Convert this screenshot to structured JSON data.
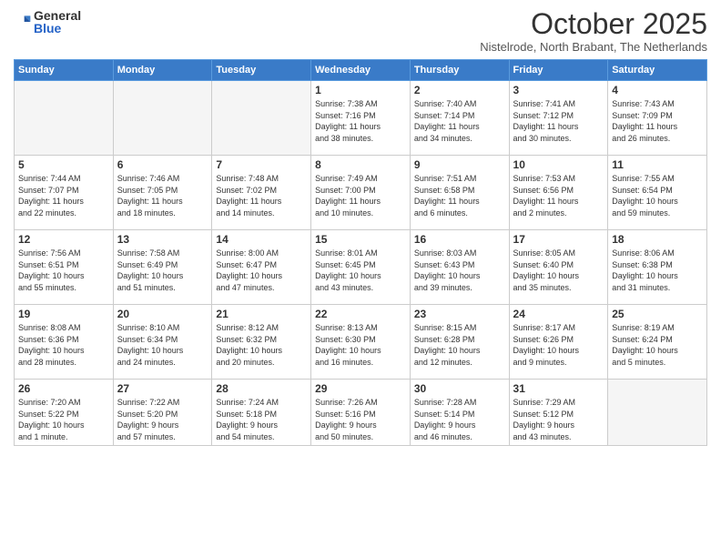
{
  "header": {
    "logo": {
      "general": "General",
      "blue": "Blue"
    },
    "title": "October 2025",
    "location": "Nistelrode, North Brabant, The Netherlands"
  },
  "days_of_week": [
    "Sunday",
    "Monday",
    "Tuesday",
    "Wednesday",
    "Thursday",
    "Friday",
    "Saturday"
  ],
  "weeks": [
    [
      {
        "day": "",
        "info": ""
      },
      {
        "day": "",
        "info": ""
      },
      {
        "day": "",
        "info": ""
      },
      {
        "day": "1",
        "info": "Sunrise: 7:38 AM\nSunset: 7:16 PM\nDaylight: 11 hours\nand 38 minutes."
      },
      {
        "day": "2",
        "info": "Sunrise: 7:40 AM\nSunset: 7:14 PM\nDaylight: 11 hours\nand 34 minutes."
      },
      {
        "day": "3",
        "info": "Sunrise: 7:41 AM\nSunset: 7:12 PM\nDaylight: 11 hours\nand 30 minutes."
      },
      {
        "day": "4",
        "info": "Sunrise: 7:43 AM\nSunset: 7:09 PM\nDaylight: 11 hours\nand 26 minutes."
      }
    ],
    [
      {
        "day": "5",
        "info": "Sunrise: 7:44 AM\nSunset: 7:07 PM\nDaylight: 11 hours\nand 22 minutes."
      },
      {
        "day": "6",
        "info": "Sunrise: 7:46 AM\nSunset: 7:05 PM\nDaylight: 11 hours\nand 18 minutes."
      },
      {
        "day": "7",
        "info": "Sunrise: 7:48 AM\nSunset: 7:02 PM\nDaylight: 11 hours\nand 14 minutes."
      },
      {
        "day": "8",
        "info": "Sunrise: 7:49 AM\nSunset: 7:00 PM\nDaylight: 11 hours\nand 10 minutes."
      },
      {
        "day": "9",
        "info": "Sunrise: 7:51 AM\nSunset: 6:58 PM\nDaylight: 11 hours\nand 6 minutes."
      },
      {
        "day": "10",
        "info": "Sunrise: 7:53 AM\nSunset: 6:56 PM\nDaylight: 11 hours\nand 2 minutes."
      },
      {
        "day": "11",
        "info": "Sunrise: 7:55 AM\nSunset: 6:54 PM\nDaylight: 10 hours\nand 59 minutes."
      }
    ],
    [
      {
        "day": "12",
        "info": "Sunrise: 7:56 AM\nSunset: 6:51 PM\nDaylight: 10 hours\nand 55 minutes."
      },
      {
        "day": "13",
        "info": "Sunrise: 7:58 AM\nSunset: 6:49 PM\nDaylight: 10 hours\nand 51 minutes."
      },
      {
        "day": "14",
        "info": "Sunrise: 8:00 AM\nSunset: 6:47 PM\nDaylight: 10 hours\nand 47 minutes."
      },
      {
        "day": "15",
        "info": "Sunrise: 8:01 AM\nSunset: 6:45 PM\nDaylight: 10 hours\nand 43 minutes."
      },
      {
        "day": "16",
        "info": "Sunrise: 8:03 AM\nSunset: 6:43 PM\nDaylight: 10 hours\nand 39 minutes."
      },
      {
        "day": "17",
        "info": "Sunrise: 8:05 AM\nSunset: 6:40 PM\nDaylight: 10 hours\nand 35 minutes."
      },
      {
        "day": "18",
        "info": "Sunrise: 8:06 AM\nSunset: 6:38 PM\nDaylight: 10 hours\nand 31 minutes."
      }
    ],
    [
      {
        "day": "19",
        "info": "Sunrise: 8:08 AM\nSunset: 6:36 PM\nDaylight: 10 hours\nand 28 minutes."
      },
      {
        "day": "20",
        "info": "Sunrise: 8:10 AM\nSunset: 6:34 PM\nDaylight: 10 hours\nand 24 minutes."
      },
      {
        "day": "21",
        "info": "Sunrise: 8:12 AM\nSunset: 6:32 PM\nDaylight: 10 hours\nand 20 minutes."
      },
      {
        "day": "22",
        "info": "Sunrise: 8:13 AM\nSunset: 6:30 PM\nDaylight: 10 hours\nand 16 minutes."
      },
      {
        "day": "23",
        "info": "Sunrise: 8:15 AM\nSunset: 6:28 PM\nDaylight: 10 hours\nand 12 minutes."
      },
      {
        "day": "24",
        "info": "Sunrise: 8:17 AM\nSunset: 6:26 PM\nDaylight: 10 hours\nand 9 minutes."
      },
      {
        "day": "25",
        "info": "Sunrise: 8:19 AM\nSunset: 6:24 PM\nDaylight: 10 hours\nand 5 minutes."
      }
    ],
    [
      {
        "day": "26",
        "info": "Sunrise: 7:20 AM\nSunset: 5:22 PM\nDaylight: 10 hours\nand 1 minute."
      },
      {
        "day": "27",
        "info": "Sunrise: 7:22 AM\nSunset: 5:20 PM\nDaylight: 9 hours\nand 57 minutes."
      },
      {
        "day": "28",
        "info": "Sunrise: 7:24 AM\nSunset: 5:18 PM\nDaylight: 9 hours\nand 54 minutes."
      },
      {
        "day": "29",
        "info": "Sunrise: 7:26 AM\nSunset: 5:16 PM\nDaylight: 9 hours\nand 50 minutes."
      },
      {
        "day": "30",
        "info": "Sunrise: 7:28 AM\nSunset: 5:14 PM\nDaylight: 9 hours\nand 46 minutes."
      },
      {
        "day": "31",
        "info": "Sunrise: 7:29 AM\nSunset: 5:12 PM\nDaylight: 9 hours\nand 43 minutes."
      },
      {
        "day": "",
        "info": ""
      }
    ]
  ]
}
